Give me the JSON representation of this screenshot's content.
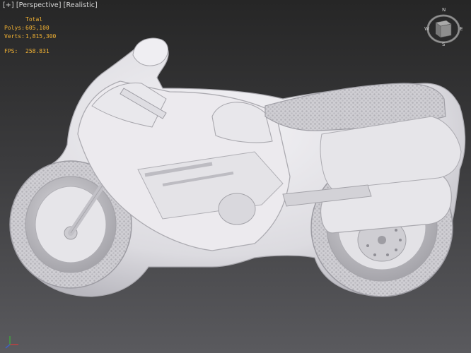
{
  "viewport": {
    "label_plus": "[+]",
    "label_view": "[Perspective]",
    "label_shading": "[Realistic]"
  },
  "stats": {
    "header": "Total",
    "polys_label": "Polys:",
    "polys_value": "605,100",
    "verts_label": "Verts:",
    "verts_value": "1,815,300",
    "fps_label": "FPS:",
    "fps_value": "258.831"
  },
  "viewcube": {
    "n": "N",
    "e": "E",
    "s": "S",
    "w": "W"
  },
  "colors": {
    "stats_text": "#f2b233",
    "bg_top": "#262626",
    "bg_bottom": "#5a5a5e",
    "model": "#e9e8ec"
  },
  "icons": [
    "viewcube-icon",
    "home-icon",
    "axis-tripod-icon"
  ]
}
